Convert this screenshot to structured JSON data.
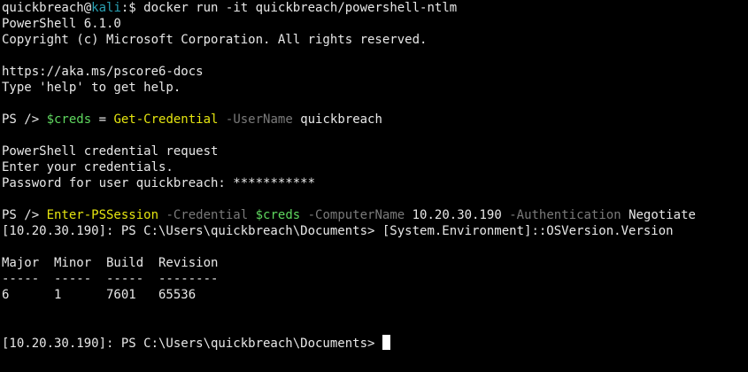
{
  "colors": {
    "background": "#000000",
    "foreground": "#e8e8e8",
    "hostname": "#2aa1b3",
    "variable": "#5fd75f",
    "cmdlet": "#e5e510",
    "parameter": "#7a7a7a"
  },
  "shell_prompt": {
    "user": "quickbreach",
    "at": "@",
    "host": "kali",
    "suffix": ":$ ",
    "command": "docker run -it quickbreach/powershell-ntlm"
  },
  "banner": {
    "version": "PowerShell 6.1.0",
    "copyright": "Copyright (c) Microsoft Corporation. All rights reserved.",
    "docs_url": "https://aka.ms/pscore6-docs",
    "help_hint": "Type 'help' to get help."
  },
  "cmd1": {
    "prompt": "PS /> ",
    "variable": "$creds",
    "operator": " = ",
    "cmdlet": "Get-Credential",
    "param": " -UserName",
    "value": " quickbreach"
  },
  "credential_request": {
    "title": "PowerShell credential request",
    "instruction": "Enter your credentials.",
    "password_label": "Password for user quickbreach: ",
    "password_mask": "***********"
  },
  "cmd2": {
    "prompt": "PS /> ",
    "cmdlet": "Enter-PSSession",
    "param1": " -Credential",
    "var1": " $creds",
    "param2": " -ComputerName",
    "value2": " 10.20.30.190",
    "param3": " -Authentication",
    "value3": " Negotiate"
  },
  "remote_cmd": {
    "prompt": "[10.20.30.190]: PS C:\\Users\\quickbreach\\Documents> ",
    "command": "[System.Environment]::OSVersion.Version"
  },
  "version_table": {
    "header": "Major  Minor  Build  Revision",
    "separator": "-----  -----  -----  --------",
    "row": "6      1      7601   65536"
  },
  "final_prompt": {
    "prompt": "[10.20.30.190]: PS C:\\Users\\quickbreach\\Documents> "
  }
}
